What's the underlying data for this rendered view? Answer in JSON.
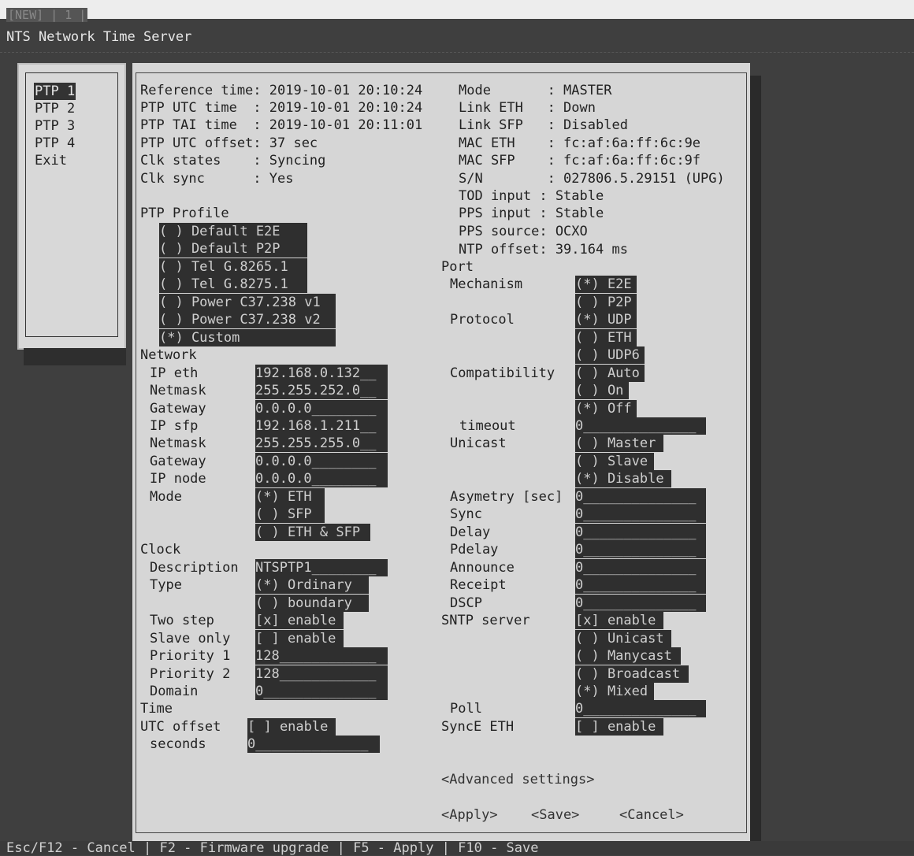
{
  "tabs": "[NEW] | 1 |",
  "app_title": "NTS Network Time Server",
  "menu": {
    "items": [
      {
        "label": "PTP 1"
      },
      {
        "label": "PTP 2"
      },
      {
        "label": "PTP 3"
      },
      {
        "label": "PTP 4"
      },
      {
        "label": "Exit"
      }
    ]
  },
  "status_left": {
    "reference_time": "Reference time: 2019-10-01 20:10:24",
    "ptp_utc_time": "PTP UTC time  : 2019-10-01 20:10:24",
    "ptp_tai_time": "PTP TAI time  : 2019-10-01 20:11:01",
    "ptp_utc_offset": "PTP UTC offset: 37 sec",
    "clk_states": "Clk states    : Syncing",
    "clk_sync": "Clk sync      : Yes"
  },
  "status_right": {
    "mode": "Mode       : MASTER",
    "link_eth": "Link ETH   : Down",
    "link_sfp": "Link SFP   : Disabled",
    "mac_eth": "MAC ETH    : fc:af:6a:ff:6c:9e",
    "mac_sfp": "MAC SFP    : fc:af:6a:ff:6c:9f",
    "sn": "S/N        : 027806.5.29151 (UPG)",
    "tod_input": "TOD input : Stable",
    "pps_input": "PPS input : Stable",
    "pps_source": "PPS source: OCXO",
    "ntp_offset": "NTP offset: 39.164 ms"
  },
  "ptp_profile": {
    "label": "PTP Profile",
    "options": [
      "( ) Default E2E",
      "( ) Default P2P",
      "( ) Tel G.8265.1",
      "( ) Tel G.8275.1",
      "( ) Power C37.238 v1",
      "( ) Power C37.238 v2",
      "(*) Custom"
    ]
  },
  "network": {
    "label": "Network",
    "ip_eth_label": "IP eth",
    "ip_eth": "192.168.0.132__",
    "netmask1_label": "Netmask",
    "netmask1": "255.255.252.0__",
    "gateway1_label": "Gateway",
    "gateway1": "0.0.0.0________",
    "ip_sfp_label": "IP sfp",
    "ip_sfp": "192.168.1.211__",
    "netmask2_label": "Netmask",
    "netmask2": "255.255.255.0__",
    "gateway2_label": "Gateway",
    "gateway2": "0.0.0.0________",
    "ip_node_label": "IP node",
    "ip_node": "0.0.0.0________",
    "mode_label": "Mode",
    "mode_eth": "(*) ETH",
    "mode_sfp": "( ) SFP",
    "mode_both": "( ) ETH & SFP"
  },
  "clock": {
    "label": "Clock",
    "description_label": "Description",
    "description": "NTSPTP1________",
    "type_label": "Type",
    "type_ordinary": "(*) Ordinary",
    "type_boundary": "( ) boundary",
    "two_step_label": "Two step",
    "two_step": "[x] enable",
    "slave_only_label": "Slave only",
    "slave_only": "[ ] enable",
    "priority1_label": "Priority 1",
    "priority1": "128____________",
    "priority2_label": "Priority 2",
    "priority2": "128____________",
    "domain_label": "Domain",
    "domain": "0______________"
  },
  "time": {
    "label": "Time",
    "utc_offset_label": "UTC offset",
    "utc_offset": "[ ] enable",
    "seconds_label": "seconds",
    "seconds": "0______________"
  },
  "port": {
    "label": "Port",
    "mechanism_label": "Mechanism",
    "mech_e2e": "(*) E2E",
    "mech_p2p": "( ) P2P",
    "protocol_label": "Protocol",
    "proto_udp": "(*) UDP",
    "proto_eth": "( ) ETH",
    "proto_udp6": "( ) UDP6",
    "compat_label": "Compatibility",
    "compat_auto": "( ) Auto",
    "compat_on": "( ) On",
    "compat_off": "(*) Off",
    "timeout_label": "timeout",
    "timeout": "0______________",
    "unicast_label": "Unicast",
    "uni_master": "( ) Master",
    "uni_slave": "( ) Slave",
    "uni_disable": "(*) Disable",
    "asym_label": "Asymetry [sec]",
    "asym": "0______________",
    "sync_label": "Sync",
    "sync": "0______________",
    "delay_label": "Delay",
    "delay": "0______________",
    "pdelay_label": "Pdelay",
    "pdelay": "0______________",
    "announce_label": "Announce",
    "announce": "0______________",
    "receipt_label": "Receipt",
    "receipt": "0______________",
    "dscp_label": "DSCP",
    "dscp": "0______________",
    "sntp_label": "SNTP server",
    "sntp_enable": "[x] enable",
    "sntp_unicast": "( ) Unicast",
    "sntp_manycast": "( ) Manycast",
    "sntp_broadcast": "( ) Broadcast",
    "sntp_mixed": "(*) Mixed",
    "poll_label": "Poll",
    "poll": "0______________",
    "synce_label": "SyncE ETH",
    "synce": "[ ] enable"
  },
  "buttons": {
    "advanced": "<Advanced settings>",
    "apply": "<Apply>",
    "save": "<Save>",
    "cancel": "<Cancel>"
  },
  "statusbar": "Esc/F12 - Cancel | F2 - Firmware upgrade | F5 - Apply | F10 - Save"
}
